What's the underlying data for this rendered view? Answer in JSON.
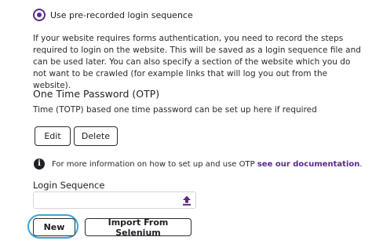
{
  "login_sequence_option": {
    "label": "Use pre-recorded login sequence",
    "selected": true
  },
  "description": "If your website requires forms authentication, you need to record the steps required to login on the website. This will be saved as a login sequence file and can be used later. You can also specify a section of the website which you do not want to be crawled (for example links that will log you out from the website).",
  "otp": {
    "title": "One Time Password (OTP)",
    "subtitle": "Time (TOTP) based one time password can be set up here if required",
    "edit_label": "Edit",
    "delete_label": "Delete"
  },
  "info": {
    "icon": "info-icon",
    "text": "For more information on how to set up and use OTP ",
    "link_text": "see our documentation",
    "suffix": "."
  },
  "login_sequence": {
    "label": "Login Sequence",
    "value": "",
    "upload_icon": "upload-icon",
    "new_label": "New",
    "import_label": "Import From Selenium"
  },
  "colors": {
    "accent": "#5b2a86",
    "highlight": "#3aa5d6"
  }
}
